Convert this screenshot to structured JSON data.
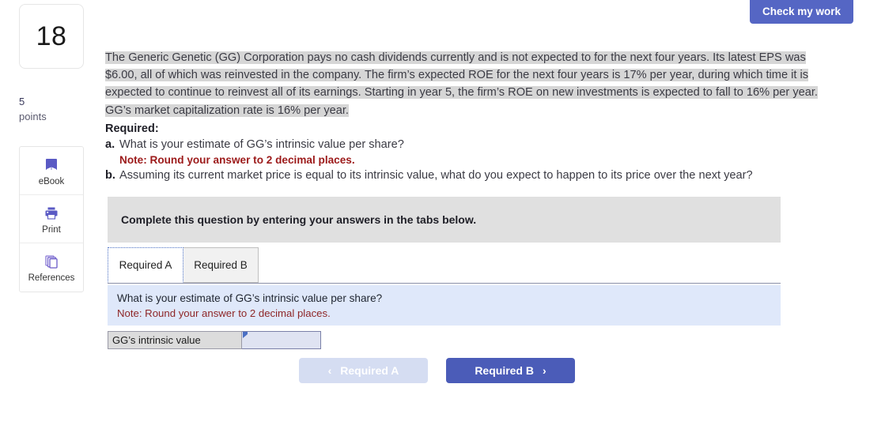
{
  "sidebar": {
    "question_number": "18",
    "points_value": "5",
    "points_label": "points",
    "tools": [
      {
        "label": "eBook",
        "icon": "book-icon"
      },
      {
        "label": "Print",
        "icon": "printer-icon"
      },
      {
        "label": "References",
        "icon": "copy-pages-icon"
      }
    ]
  },
  "toolbar": {
    "check_my_work_label": "Check my work"
  },
  "question": {
    "stem": "The Generic Genetic (GG) Corporation pays no cash dividends currently and is not expected to for the next four years. Its latest EPS was $6.00, all of which was reinvested in the company. The firm’s expected ROE for the next four years is 17% per year, during which time it is  expected to continue to reinvest all of its earnings. Starting in year 5, the firm’s ROE on new investments is expected to fall to 16% per year. GG’s market capitalization rate is 16% per year.",
    "required_heading": "Required:",
    "parts": [
      {
        "letter": "a.",
        "text": "What is your estimate of GG’s intrinsic value per share?",
        "note": "Note: Round your answer to 2 decimal places."
      },
      {
        "letter": "b.",
        "text": "Assuming its current market price is equal to its intrinsic value, what do you expect to happen to its price over the next year?",
        "note": ""
      }
    ]
  },
  "banner": {
    "instruction": "Complete this question by entering your answers in the tabs below."
  },
  "tabs": [
    {
      "label": "Required A",
      "active": true
    },
    {
      "label": "Required B",
      "active": false
    }
  ],
  "info_panel": {
    "question_text": "What is your estimate of GG’s intrinsic value per share?",
    "note_text": "Note: Round your answer to 2 decimal places."
  },
  "answer": {
    "row_label": "GG’s intrinsic value",
    "value": "",
    "placeholder": ""
  },
  "nav": {
    "prev_label": "Required A",
    "prev_icon": "chevron-left-icon",
    "next_label": "Required B",
    "next_icon": "chevron-right-icon"
  },
  "colors": {
    "accent_blue": "#4b5cb8",
    "check_button": "#5566c4",
    "highlight_gray": "#d6d6d6",
    "banner_gray": "#e0e0e0",
    "info_blue": "#dfe8fa",
    "note_red": "#9c1a1a",
    "prev_disabled": "#d5ddf2"
  }
}
